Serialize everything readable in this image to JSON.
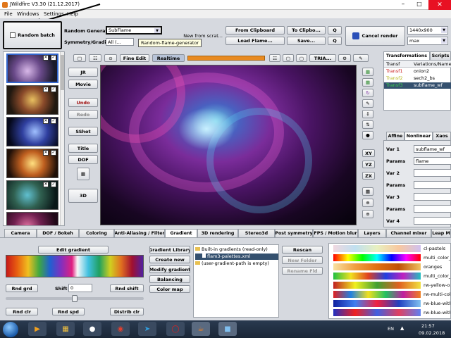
{
  "window": {
    "title": "JWildfire V3.30 (21.12.2017)"
  },
  "menu": [
    "File",
    "Windows",
    "Settings",
    "Help"
  ],
  "toolbar": {
    "random_batch": "Random batch",
    "random_generator_label": "Random Generator",
    "random_generator_value": "SubFlame",
    "tooltip": "Random-flame-generator",
    "symmetry_label": "Symmetry/Gradient",
    "symmetry_value": "All (...",
    "new_from_scratch": "New from scrat...",
    "from_clipboard": "From Clipboard",
    "to_clipboard": "To Clipbo...",
    "load_flame": "Load Flame...",
    "save": "Save...",
    "q1": "Q",
    "q2": "Q",
    "cancel_render": "Cancel render",
    "resolution": "1440x900",
    "quality": "max"
  },
  "render_toolbar": {
    "fine_edit": "Fine Edit",
    "realtime": "Realtime",
    "tria": "TRIA..."
  },
  "side_buttons": {
    "jr": "JR",
    "movie": "Movie",
    "undo": "Undo",
    "redo": "Redo",
    "sshot": "SShot",
    "title": "Title",
    "dof": "DOF",
    "three_d": "3D"
  },
  "axis_buttons": [
    "XY",
    "YZ",
    "ZX"
  ],
  "right_panel": {
    "tabs": [
      "Transformations",
      "Scripts"
    ],
    "table_headers": [
      "Transf",
      "Variations/Name"
    ],
    "rows": [
      {
        "transf": "Transf1",
        "name": "onion2",
        "color": "#cc2222"
      },
      {
        "transf": "Transf2",
        "name": "sech2_bs",
        "color": "#b8b822"
      },
      {
        "transf": "Transf3",
        "name": "subflame_wf",
        "color": "#22aa33"
      }
    ],
    "subtabs": [
      "Affine",
      "Nonlinear",
      "Xaos"
    ],
    "var1_label": "Var 1",
    "var1_value": "subflame_wf",
    "params_label": "Params",
    "params_value": "flame",
    "var2_label": "Var 2",
    "params2_label": "Params",
    "var3_label": "Var 3",
    "params3_label": "Params",
    "var4_label": "Var 4"
  },
  "bottom_tabs": [
    "Camera",
    "DOF / Bokeh",
    "Coloring",
    "Anti-Aliasing / Filter",
    "Gradient",
    "3D rendering",
    "Stereo3d",
    "Post symmetry",
    "FPS / Motion blur",
    "Layers",
    "Channel mixer",
    "Leap M"
  ],
  "gradient": {
    "edit_gradient": "Edit gradient",
    "rnd_grd": "Rnd grd",
    "shift_label": "Shift",
    "shift_value": "0",
    "rnd_shift": "Rnd shift",
    "rnd_clr": "Rnd clr",
    "rnd_spd": "Rnd spd",
    "distrib_clr": "Distrib clr",
    "library": "Gradient Library",
    "create_new": "Create new",
    "modify_gradient": "Modify gradient",
    "balancing": "Balancing",
    "color_map": "Color map",
    "tree": [
      "Built-in gradients (read-only)",
      "flam3-palettes.xml",
      "(user-gradient-path is empty)"
    ],
    "rescan": "Rescan",
    "new_folder": "New Folder",
    "rename_fld": "Rename Fld",
    "palettes": [
      "cl-pastels",
      "multi_color_...",
      "oranges",
      "multi_color_...",
      "rw-yellow-o...",
      "rw-multi-colo...",
      "rw-blue-with...",
      "rw-blue-with..."
    ]
  },
  "taskbar": {
    "lang": "EN",
    "time": "21:57",
    "date": "09.02.2018"
  }
}
